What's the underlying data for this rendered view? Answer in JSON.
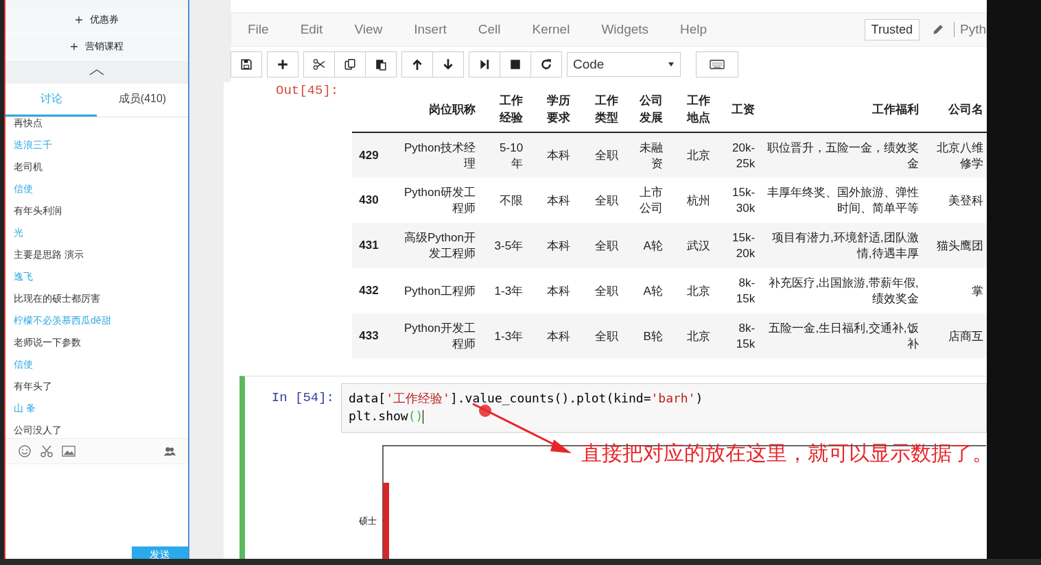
{
  "sidebar": {
    "actions": [
      "优惠券",
      "营销课程"
    ],
    "tabs": [
      {
        "label": "讨论",
        "selected": true
      },
      {
        "label": "成员(410)",
        "selected": false
      }
    ],
    "messages": [
      {
        "text": "再快点"
      },
      {
        "sender": "迭浪三千",
        "text": "老司机"
      },
      {
        "sender": "信使",
        "text": "有年头利润"
      },
      {
        "sender": "光",
        "text": "主要是思路 演示"
      },
      {
        "sender": "逸飞",
        "text": "比现在的硕士都厉害"
      },
      {
        "sender": "柠檬不必羡慕西瓜dě甜",
        "text": "老师说一下参数"
      },
      {
        "sender": "信使",
        "text": "有年头了"
      },
      {
        "sender": "山 夆",
        "text": "公司没人了"
      }
    ],
    "send_button": "发送"
  },
  "notebook": {
    "menu": [
      "File",
      "Edit",
      "View",
      "Insert",
      "Cell",
      "Kernel",
      "Widgets",
      "Help"
    ],
    "trusted": "Trusted",
    "kernel": "Pyth",
    "cell_type": "Code",
    "output_prompt": "Out[45]:",
    "table": {
      "columns": [
        "岗位职称",
        "工作经验",
        "学历要求",
        "工作类型",
        "公司发展",
        "工作地点",
        "工资",
        "工作福利",
        "公司名"
      ],
      "rows": [
        {
          "index": "429",
          "cells": [
            "Python技术经理",
            "5-10年",
            "本科",
            "全职",
            "未融资",
            "北京",
            "20k-25k",
            "职位晋升，五险一金，绩效奖金",
            "北京八维修学"
          ]
        },
        {
          "index": "430",
          "cells": [
            "Python研发工程师",
            "不限",
            "本科",
            "全职",
            "上市公司",
            "杭州",
            "15k-30k",
            "丰厚年终奖、国外旅游、弹性时间、简单平等",
            "美登科"
          ]
        },
        {
          "index": "431",
          "cells": [
            "高级Python开发工程师",
            "3-5年",
            "本科",
            "全职",
            "A轮",
            "武汉",
            "15k-20k",
            "项目有潜力,环境舒适,团队激情,待遇丰厚",
            "猫头鹰团"
          ]
        },
        {
          "index": "432",
          "cells": [
            "Python工程师",
            "1-3年",
            "本科",
            "全职",
            "A轮",
            "北京",
            "8k-15k",
            "补充医疗,出国旅游,带薪年假,绩效奖金",
            "掌"
          ]
        },
        {
          "index": "433",
          "cells": [
            "Python开发工程师",
            "1-3年",
            "本科",
            "全职",
            "B轮",
            "北京",
            "8k-15k",
            "五险一金,生日福利,交通补,饭补",
            "店商互"
          ]
        }
      ]
    },
    "input_prompt": "In [54]:",
    "code": [
      [
        {
          "kind": "plain",
          "text": "data["
        },
        {
          "kind": "string",
          "text": "'工作经验'"
        },
        {
          "kind": "plain",
          "text": "].value_counts().plot(kind="
        },
        {
          "kind": "string",
          "text": "'barh'"
        },
        {
          "kind": "plain",
          "text": ")"
        }
      ],
      [
        {
          "kind": "plain",
          "text": "plt.show"
        },
        {
          "kind": "paren",
          "text": "()"
        }
      ]
    ],
    "annotation": "直接把对应的放在这里，就可以显示数据了。",
    "chart_label": "硕士"
  }
}
